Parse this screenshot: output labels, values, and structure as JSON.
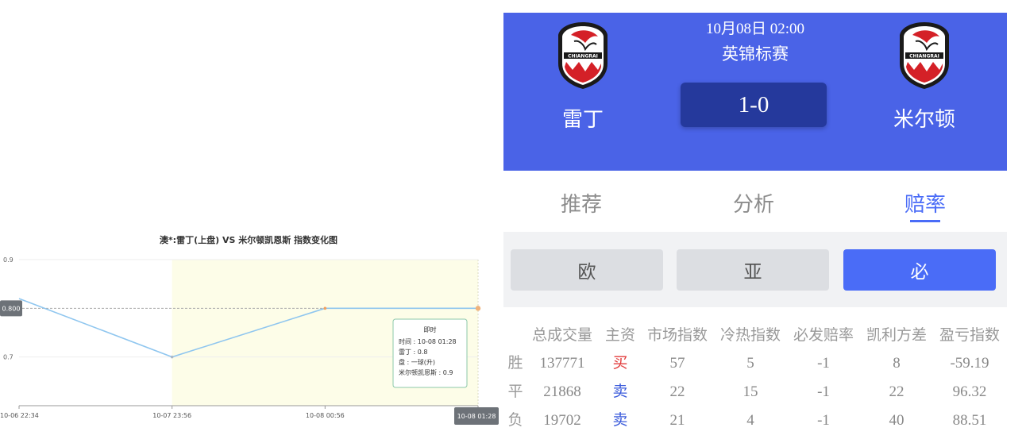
{
  "chart_data": {
    "type": "line",
    "title": "澳*:雷丁(上盘) VS 米尔顿凯恩斯 指数变化图",
    "x": [
      "10-06 22:34",
      "10-07 23:56",
      "10-08 00:56",
      "10-08 01:28"
    ],
    "series": [
      {
        "values": [
          0.82,
          0.7,
          0.8,
          0.8
        ]
      }
    ],
    "yticks": [
      "0.9",
      "0.7"
    ],
    "ylim": [
      0.6,
      0.9
    ],
    "ref_value": 0.8,
    "ref_label": "0.800",
    "highlight_from_index": 1,
    "grid": true,
    "line_color": "#8fc6ef",
    "highlight_color": "#fdfde8",
    "tooltip": {
      "title": "即时",
      "lines": [
        "时间 : 10-08 01:28",
        "雷丁 : 0.8",
        "盘 : 一球(升)",
        "米尔顿凯恩斯 : 0.9"
      ]
    }
  },
  "match": {
    "datetime": "10月08日 02:00",
    "league": "英锦标赛",
    "score": "1-0",
    "home_team": "雷丁",
    "away_team": "米尔顿",
    "logo_text": "CHIANGRAI"
  },
  "tabs": [
    "推荐",
    "分析",
    "赔率"
  ],
  "active_tab": 2,
  "sub_tabs": [
    "欧",
    "亚",
    "必"
  ],
  "active_sub_tab": 2,
  "odds": {
    "headers": [
      "总成交量",
      "主资",
      "市场指数",
      "冷热指数",
      "必发赔率",
      "凯利方差",
      "盈亏指数"
    ],
    "rows": [
      {
        "label": "胜",
        "values": [
          "137771",
          "买",
          "57",
          "5",
          "-1",
          "8",
          "-59.19"
        ]
      },
      {
        "label": "平",
        "values": [
          "21868",
          "卖",
          "22",
          "15",
          "-1",
          "22",
          "96.32"
        ]
      },
      {
        "label": "负",
        "values": [
          "19702",
          "卖",
          "21",
          "4",
          "-1",
          "40",
          "88.51"
        ]
      }
    ]
  },
  "colors": {
    "header_bg": "#4a63e7",
    "score_bg": "#25399c",
    "accent": "#4a6cf7",
    "buy": "#e23c3c",
    "sell": "#3b5bdb"
  }
}
